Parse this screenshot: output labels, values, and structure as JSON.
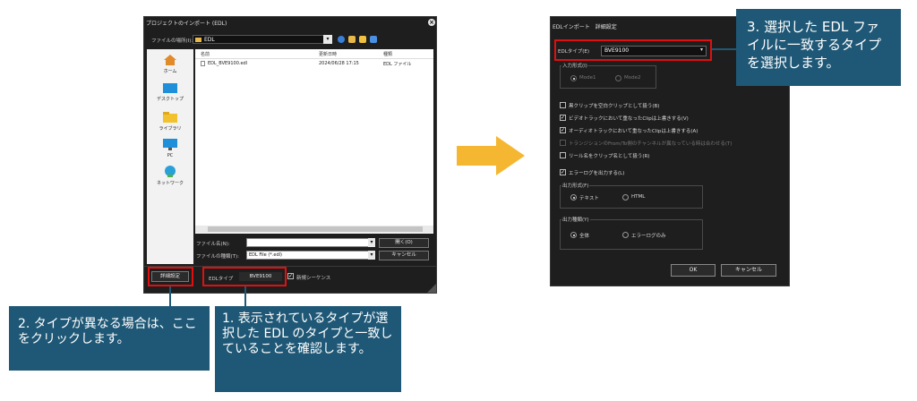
{
  "import_dialog": {
    "title": "プロジェクトのインポート (EDL)",
    "location_label": "ファイルの場所(I):",
    "location_value": "EDL",
    "places": [
      "ホーム",
      "デスクトップ",
      "ライブラリ",
      "PC",
      "ネットワーク"
    ],
    "columns": [
      "名前",
      "更新日時",
      "種類"
    ],
    "files": [
      {
        "name": "EDL_BVE9100.edl",
        "date": "2024/06/28 17:15",
        "type": "EDL ファイル"
      }
    ],
    "filename_label": "ファイル名(N):",
    "filetype_label": "ファイルの種類(T):",
    "filetype_value": "EDL File (*.edl)",
    "open_button": "開く(O)",
    "cancel_button": "キャンセル",
    "detail_button": "詳細設定",
    "edl_type_label": "EDLタイプ",
    "edl_type_value": "BVE9100",
    "new_sequence_label": "新規シーケンス"
  },
  "detail_dialog": {
    "title": "EDLインポート　詳細設定",
    "edl_type_label": "EDLタイプ(E)",
    "edl_type_value": "BVE9100",
    "input_format_label": "入力形式(I)",
    "modes": [
      "Mode1",
      "Mode2"
    ],
    "options": [
      {
        "label": "黒クリップを空白クリップとして扱う(B)",
        "checked": false,
        "disabled": false
      },
      {
        "label": "ビデオトラックにおいて重なったClipは上書きする(V)",
        "checked": true,
        "disabled": false
      },
      {
        "label": "オーディオトラックにおいて重なったClipは上書きする(A)",
        "checked": true,
        "disabled": false
      },
      {
        "label": "トランジションのFrom/To側のチャンネルが異なっている時は合わせる(T)",
        "checked": false,
        "disabled": true
      },
      {
        "label": "リール名をクリップ名として扱う(R)",
        "checked": false,
        "disabled": false
      },
      {
        "label": "エラーログを出力する(L)",
        "checked": true,
        "disabled": false
      }
    ],
    "output_format_label": "出力形式(F)",
    "output_formats": [
      "テキスト",
      "HTML"
    ],
    "output_kind_label": "出力種類(Y)",
    "output_kinds": [
      "全体",
      "エラーログのみ"
    ],
    "ok_button": "OK",
    "cancel_button": "キャンセル"
  },
  "callouts": {
    "step1": "1. 表示されているタイプが選択した EDL のタイプと一致していることを確認します。",
    "step2": "2. タイプが異なる場合は、ここをクリックします。",
    "step3": "3. 選択した EDL ファイルに一致するタイプを選択します。"
  },
  "colors": {
    "callout_bg": "#1f5876",
    "highlight": "#e01010",
    "arrow": "#f5b731",
    "dialog_bg": "#1e1e1e"
  }
}
